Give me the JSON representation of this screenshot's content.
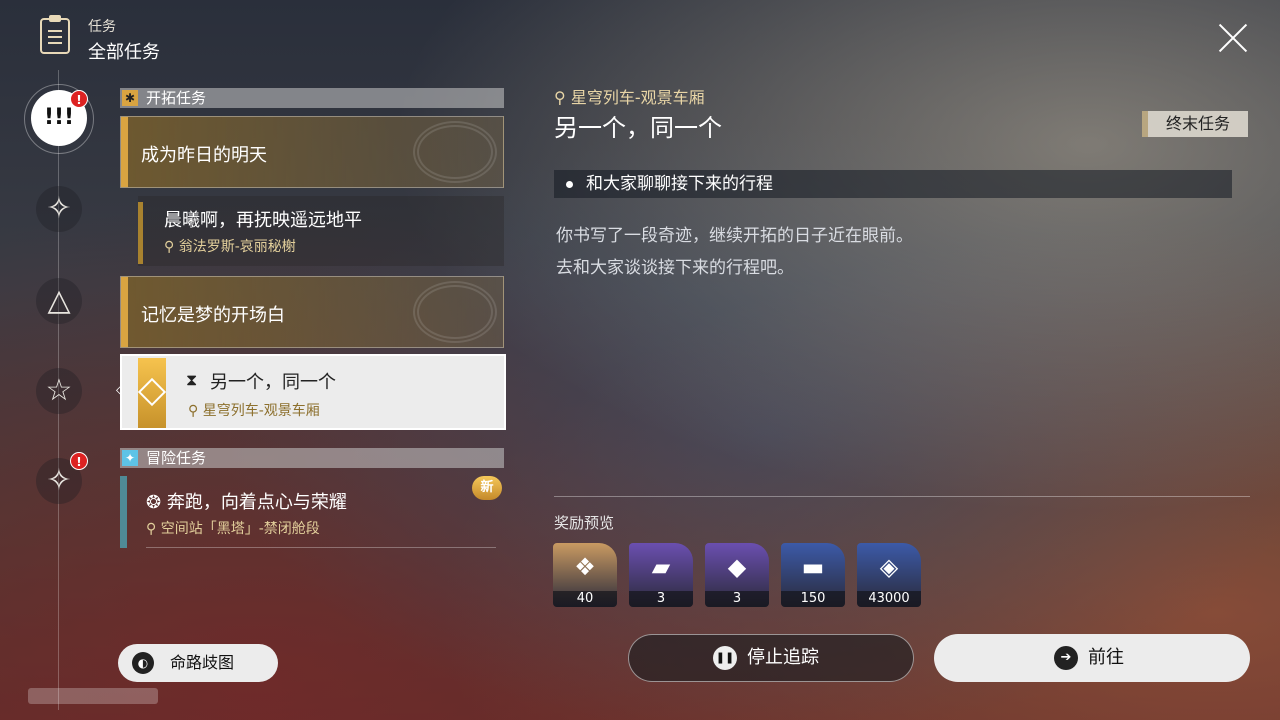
{
  "header": {
    "category": "任务",
    "title": "全部任务"
  },
  "rail": {
    "active_icon": "!!!",
    "badge": "!",
    "items": [
      "trailblaze-star-icon",
      "triangle-icon",
      "star-icon",
      "companion-star-icon"
    ]
  },
  "sections": {
    "trailblaze": {
      "label": "开拓任务"
    },
    "adventure": {
      "label": "冒险任务"
    }
  },
  "quests": {
    "q1": {
      "title": "成为昨日的明天"
    },
    "q1_sub": {
      "title": "晨曦啊，再抚映遥远地平",
      "location": "翁法罗斯-哀丽秘榭"
    },
    "q2": {
      "title": "记忆是梦的开场白"
    },
    "selected": {
      "title": "另一个，同一个",
      "location": "星穹列车-观景车厢"
    },
    "adventure1": {
      "title": "奔跑，向着点心与荣耀",
      "location": "空间站「黑塔」-禁闭舱段",
      "badge": "新"
    }
  },
  "path_button": {
    "label": "命路歧图"
  },
  "detail": {
    "location": "星穹列车-观景车厢",
    "title": "另一个，同一个",
    "tag": "终末任务",
    "objective": "和大家聊聊接下来的行程",
    "description_line1": "你书写了一段奇迹，继续开拓的日子近在眼前。",
    "description_line2": "去和大家谈谈接下来的行程吧。"
  },
  "rewards": {
    "label": "奖励预览",
    "items": [
      {
        "icon": "crystal-icon",
        "count": "40",
        "color": "#c99a62"
      },
      {
        "icon": "purple-book-icon",
        "count": "3",
        "color": "#6b4fb0"
      },
      {
        "icon": "purple-item-icon",
        "count": "3",
        "color": "#6b4fb0"
      },
      {
        "icon": "credit-icon",
        "count": "150",
        "color": "#3c5aa8"
      },
      {
        "icon": "ticket-icon",
        "count": "43000",
        "color": "#3c5aa8"
      }
    ]
  },
  "actions": {
    "stop": "停止追踪",
    "go": "前往"
  }
}
